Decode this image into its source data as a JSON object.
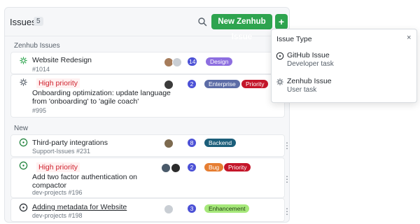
{
  "header": {
    "title": "Issues",
    "count": "5",
    "search_icon": "search-icon",
    "new_button_label": "New Zenhub Issue",
    "add_label": "+"
  },
  "sections": [
    {
      "label": "Zenhub Issues",
      "issues": [
        {
          "icon": "zenhub-gear-icon",
          "priority": "",
          "title": "Website Redesign",
          "subtitle": "#1014",
          "count": "14",
          "labels": [
            {
              "text": "Design",
              "color": "#8d6ee0"
            }
          ]
        },
        {
          "icon": "zenhub-gear-icon",
          "priority": "High priority",
          "title": "Onboarding optimization: update language from 'onboarding' to 'agile coach'",
          "subtitle": "#995",
          "count": "2",
          "labels": [
            {
              "text": "Enterprise",
              "color": "#5c6ca6"
            },
            {
              "text": "Priority",
              "color": "#c4162a"
            }
          ]
        }
      ]
    },
    {
      "label": "New",
      "issues": [
        {
          "icon": "github-issue-icon",
          "priority": "",
          "title": "Third-party integrations",
          "subtitle": "Support-Issues #231",
          "count": "8",
          "labels": [
            {
              "text": "Backend",
              "color": "#1b5e7a"
            }
          ]
        },
        {
          "icon": "github-issue-icon",
          "priority": "High priority",
          "title": "Add two factor authentication on compactor",
          "subtitle": "dev-projects #196",
          "count": "2",
          "labels": [
            {
              "text": "Bug",
              "color": "#e67e32"
            },
            {
              "text": "Priority",
              "color": "#c4162a"
            }
          ]
        },
        {
          "icon": "github-issue-icon",
          "priority": "",
          "title": "Adding metadata for Website",
          "subtitle": "dev-projects #198",
          "count": "3",
          "labels": [
            {
              "text": "Enhancement",
              "color": "#a6e87a"
            }
          ]
        }
      ]
    }
  ],
  "dropdown": {
    "title": "Issue Type",
    "close": "×",
    "items": [
      {
        "icon": "github-issue-icon",
        "name": "GitHub Issue",
        "description": "Developer task"
      },
      {
        "icon": "zenhub-gear-icon",
        "name": "Zenhub Issue",
        "description": "User task"
      }
    ]
  },
  "colors": {
    "accent_green": "#2ea44f",
    "count_badge": "#4c51d6",
    "priority_red": "#cf222e",
    "issue_open_green": "#1a7f37"
  },
  "kebab": "⋮"
}
